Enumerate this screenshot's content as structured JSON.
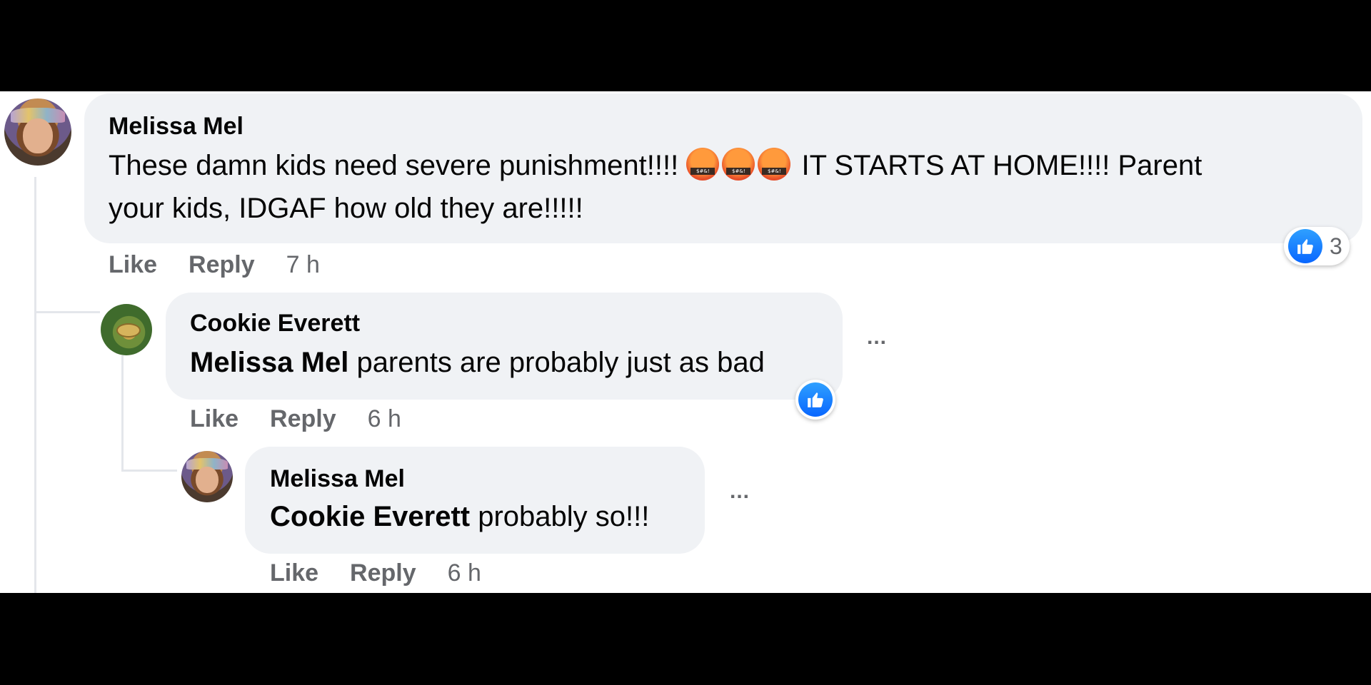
{
  "comments": [
    {
      "author": "Melissa Mel",
      "text_part1": "These damn kids need severe punishment!!!! ",
      "emojis": [
        "angry-cursing-face",
        "angry-cursing-face",
        "angry-cursing-face"
      ],
      "text_part2": " IT STARTS AT HOME!!!! Parent",
      "text_line2": "your kids, IDGAF how old they are!!!!!",
      "actions": {
        "like": "Like",
        "reply": "Reply",
        "time": "7 h"
      },
      "reaction": {
        "icon": "thumbs-up",
        "count": "3"
      }
    },
    {
      "author": "Cookie Everett",
      "mention": "Melissa Mel",
      "text": " parents are probably just as bad",
      "actions": {
        "like": "Like",
        "reply": "Reply",
        "time": "6 h"
      },
      "reaction": {
        "icon": "thumbs-up"
      },
      "more": "..."
    },
    {
      "author": "Melissa Mel",
      "mention": "Cookie Everett",
      "text": " probably so!!!",
      "actions": {
        "like": "Like",
        "reply": "Reply",
        "time": "6 h"
      },
      "more": "..."
    }
  ],
  "colors": {
    "bubble": "#f0f2f5",
    "like_blue": "#0866ff",
    "meta_gray": "#65676b",
    "frame": "#000000"
  }
}
